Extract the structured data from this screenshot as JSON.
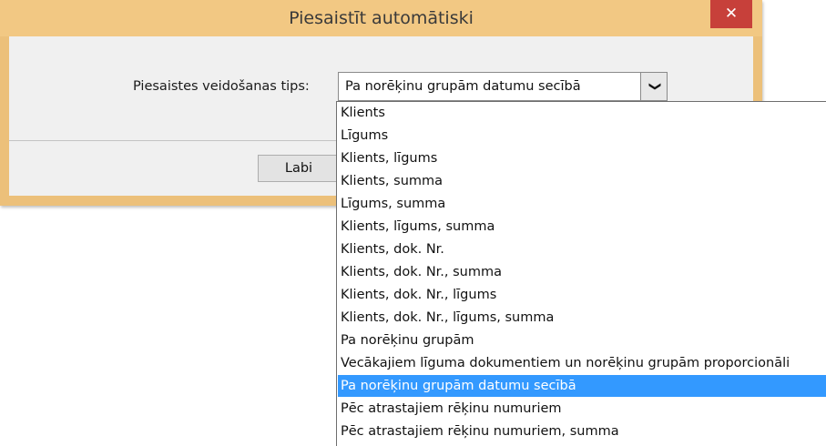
{
  "window": {
    "title": "Piesaistīt automātiski",
    "close_label": "✕"
  },
  "form": {
    "type_label": "Piesaistes veidošanas tips:",
    "selected_value": "Pa norēķinu grupām datumu secībā",
    "dropdown_arrow": "❯",
    "ok_label": "Labi"
  },
  "dropdown": {
    "options": [
      "Klients",
      "Līgums",
      "Klients, līgums",
      "Klients, summa",
      "Līgums, summa",
      "Klients, līgums, summa",
      "Klients, dok. Nr.",
      "Klients, dok. Nr., summa",
      "Klients, dok. Nr., līgums",
      "Klients, dok. Nr., līgums, summa",
      "Pa norēķinu grupām",
      "Vecākajiem līguma dokumentiem un norēķinu grupām proporcionāli",
      "Pa norēķinu grupām datumu secībā",
      "Pēc atrastajiem rēķinu numuriem",
      "Pēc atrastajiem rēķinu numuriem, summa"
    ],
    "selected_index": 12
  },
  "colors": {
    "title_bar": "#f2c883",
    "close_button": "#c7403a",
    "selection": "#3399ff"
  }
}
